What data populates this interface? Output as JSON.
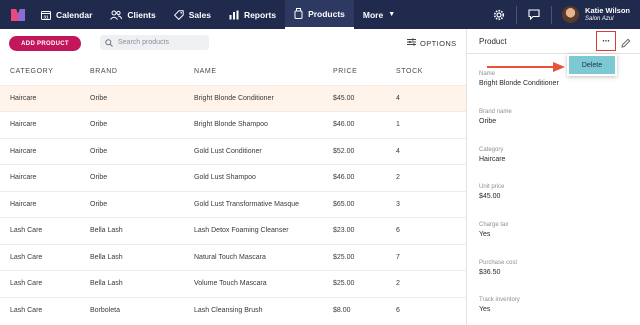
{
  "nav": {
    "items": [
      {
        "label": "Calendar",
        "icon": "calendar-icon"
      },
      {
        "label": "Clients",
        "icon": "clients-icon"
      },
      {
        "label": "Sales",
        "icon": "tag-icon"
      },
      {
        "label": "Reports",
        "icon": "bar-chart-icon"
      },
      {
        "label": "Products",
        "icon": "products-icon",
        "active": true
      },
      {
        "label": "More",
        "icon": "chevron-down-icon"
      }
    ],
    "calendar_day": "31"
  },
  "user": {
    "name": "Katie Wilson",
    "salon": "Salon Azul"
  },
  "toolbar": {
    "add_label": "ADD PRODUCT",
    "search_placeholder": "Search products",
    "options_label": "OPTIONS"
  },
  "table": {
    "headers": [
      "CATEGORY",
      "BRAND",
      "NAME",
      "PRICE",
      "STOCK"
    ],
    "rows": [
      [
        "Haircare",
        "Oribe",
        "Bright Blonde Conditioner",
        "$45.00",
        "4"
      ],
      [
        "Haircare",
        "Oribe",
        "Bright Blonde Shampoo",
        "$46.00",
        "1"
      ],
      [
        "Haircare",
        "Oribe",
        "Gold Lust Conditioner",
        "$52.00",
        "4"
      ],
      [
        "Haircare",
        "Oribe",
        "Gold Lust Shampoo",
        "$46.00",
        "2"
      ],
      [
        "Haircare",
        "Oribe",
        "Gold Lust Transformative Masque",
        "$65.00",
        "3"
      ],
      [
        "Lash Care",
        "Bella Lash",
        "Lash Detox Foaming Cleanser",
        "$23.00",
        "6"
      ],
      [
        "Lash Care",
        "Bella Lash",
        "Natural Touch Mascara",
        "$25.00",
        "7"
      ],
      [
        "Lash Care",
        "Bella Lash",
        "Volume Touch Mascara",
        "$25.00",
        "2"
      ],
      [
        "Lash Care",
        "Borboleta",
        "Lash Cleansing Brush",
        "$8.00",
        "6"
      ]
    ]
  },
  "panel": {
    "title": "Product",
    "more_label": "···",
    "menu_item": "Delete",
    "fields": [
      {
        "label": "Name",
        "value": "Bright Blonde Conditioner"
      },
      {
        "label": "Brand name",
        "value": "Oribe"
      },
      {
        "label": "Category",
        "value": "Haircare"
      },
      {
        "label": "Unit price",
        "value": "$45.00"
      },
      {
        "label": "Charge tax",
        "value": "Yes"
      },
      {
        "label": "Purchase cost",
        "value": "$36.50"
      },
      {
        "label": "Track inventory",
        "value": "Yes"
      }
    ]
  },
  "colors": {
    "topbar": "#1f2a4d",
    "accent": "#c2185b",
    "highlight": "#e53935",
    "menu_item_bg": "#7cc9d3",
    "selected_row": "#fff3ea"
  }
}
